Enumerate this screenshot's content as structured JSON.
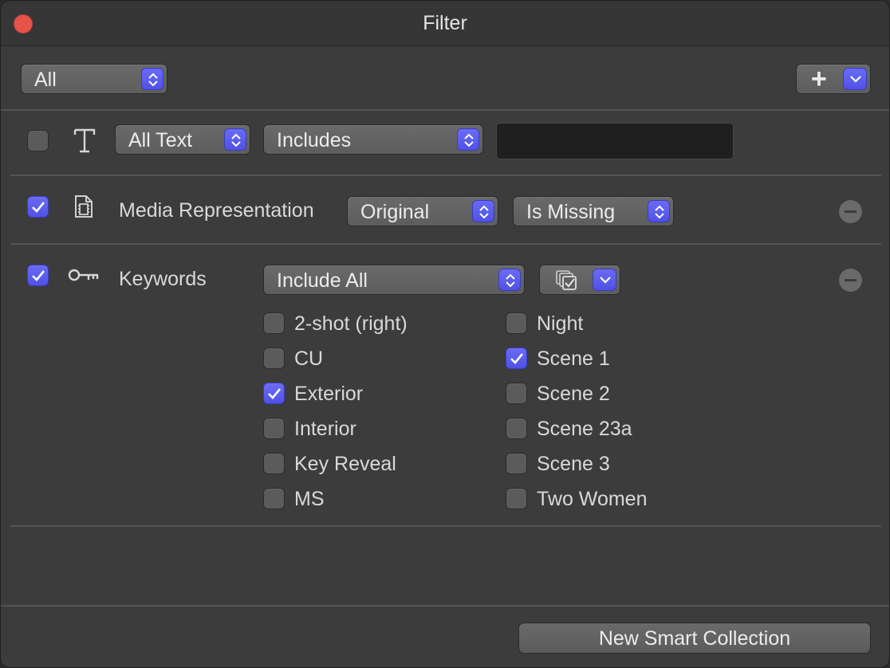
{
  "window": {
    "title": "Filter"
  },
  "toolbar": {
    "match_value": "All",
    "add_symbol": "+"
  },
  "text_rule": {
    "field": "All Text",
    "operator": "Includes",
    "value": ""
  },
  "media_rule": {
    "label": "Media Representation",
    "representation": "Original",
    "condition": "Is Missing"
  },
  "keyword_rule": {
    "label": "Keywords",
    "mode": "Include All",
    "keywords_left": [
      {
        "name": "2-shot (right)",
        "checked": false
      },
      {
        "name": "CU",
        "checked": false
      },
      {
        "name": "Exterior",
        "checked": true
      },
      {
        "name": "Interior",
        "checked": false
      },
      {
        "name": "Key Reveal",
        "checked": false
      },
      {
        "name": "MS",
        "checked": false
      }
    ],
    "keywords_right": [
      {
        "name": "Night",
        "checked": false
      },
      {
        "name": "Scene 1",
        "checked": true
      },
      {
        "name": "Scene 2",
        "checked": false
      },
      {
        "name": "Scene 23a",
        "checked": false
      },
      {
        "name": "Scene 3",
        "checked": false
      },
      {
        "name": "Two Women",
        "checked": false
      }
    ]
  },
  "footer": {
    "new_collection_label": "New Smart Collection"
  },
  "colors": {
    "accent": "#5b5df0",
    "close": "#e5534b"
  }
}
